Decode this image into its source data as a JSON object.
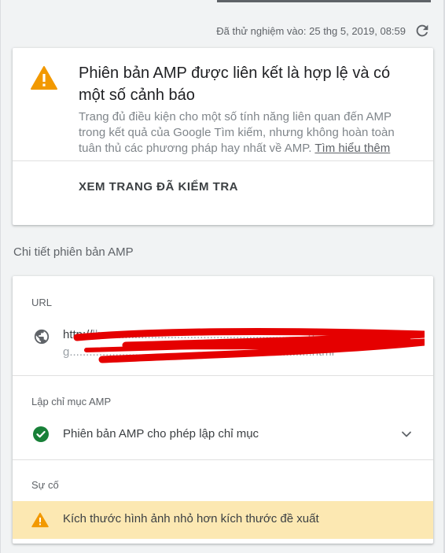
{
  "header": {
    "tested_at": "Đã thử nghiệm vào: 25 thg 5, 2019, 08:59",
    "refresh_icon": "refresh-icon"
  },
  "status_card": {
    "icon": "warning-icon",
    "icon_color": "#f29900",
    "title": "Phiên bản AMP được liên kết là hợp lệ và có một số cảnh báo",
    "description": "Trang đủ điều kiện cho một số tính năng liên quan đến AMP trong kết quả của Google Tìm kiếm, nhưng không hoàn toàn tuân thủ các phương pháp hay nhất về AMP.",
    "learn_more": "Tìm hiểu thêm",
    "action_label": "XEM TRANG ĐÃ KIỂM TRA"
  },
  "details_section": {
    "title": "Chi tiết phiên bản AMP"
  },
  "details_card": {
    "url_label": "URL",
    "url_icon": "globe-icon",
    "url_value": "http://",
    "url_redacted": true,
    "indexing_label": "Lập chỉ mục AMP",
    "indexing_status": "Phiên bản AMP cho phép lập chỉ mục",
    "indexing_icon": "check-circle-icon",
    "indexing_color": "#188038",
    "issues_label": "Sự cố",
    "issue_text": "Kích thước hình ảnh nhỏ hơn kích thước đề xuất",
    "issue_background": "#fce8b2",
    "redaction_color": "#e50000"
  }
}
